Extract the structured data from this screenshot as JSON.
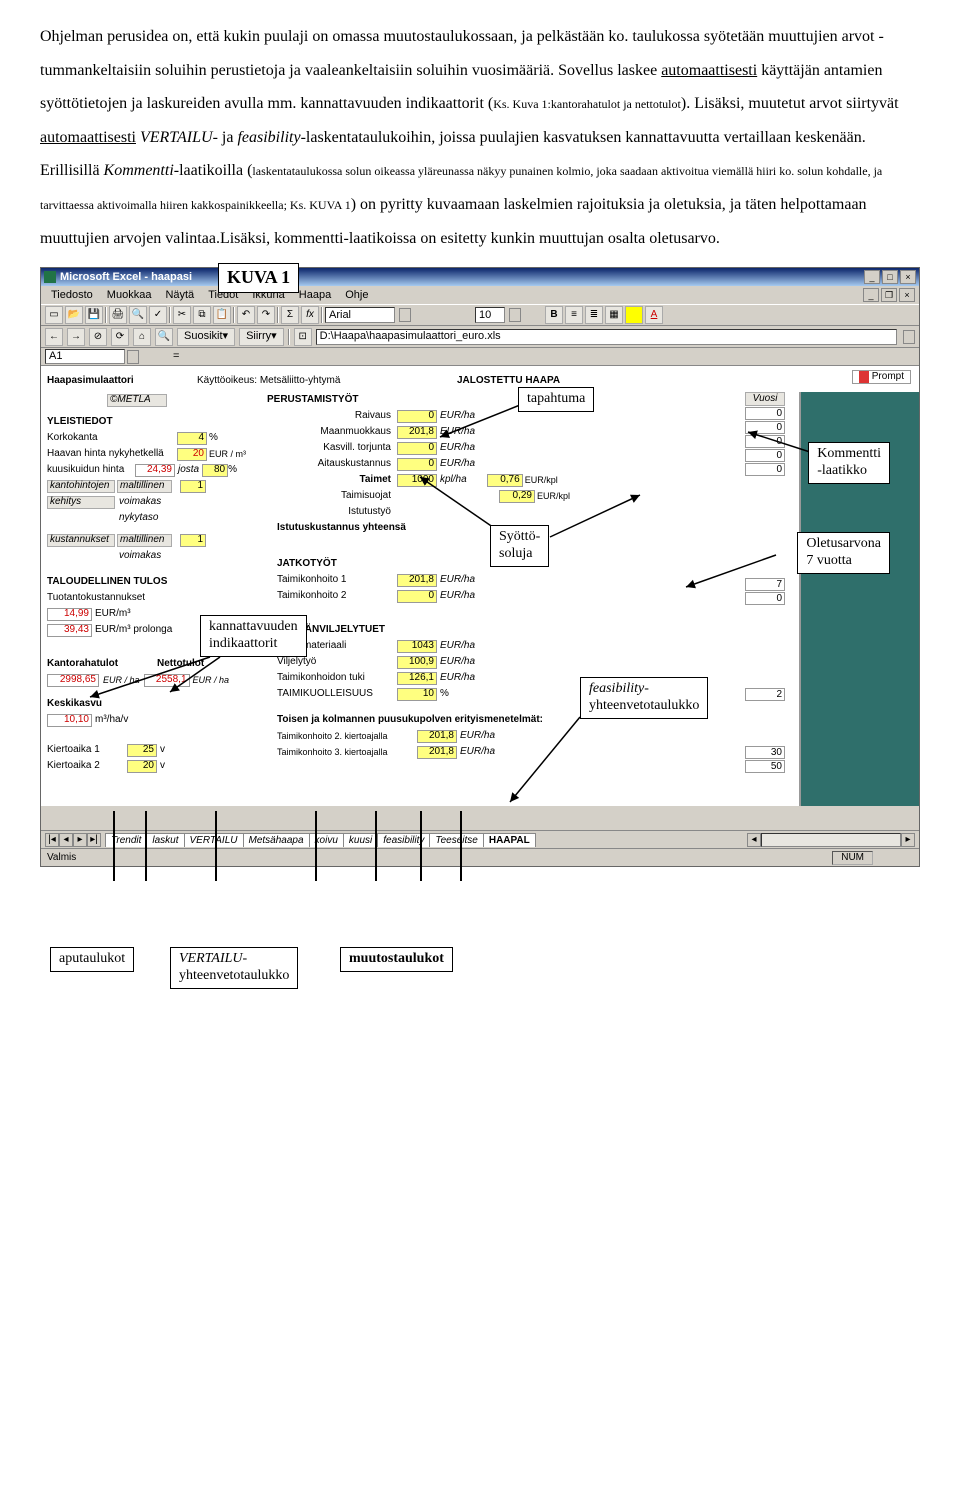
{
  "text": {
    "para": "Ohjelman perusidea on, että kukin puulaji on omassa muutostaulukossaan, ja pelkästään ko. taulukossa syötetään muuttujien arvot - tummankeltaisiin soluihin perustietoja ja vaaleankeltaisiin soluihin vuosimääriä. Sovellus laskee ",
    "ul1": "automaattisesti",
    "para2": " käyttäjän antamien syöttötietojen ja laskureiden avulla mm. kannattavuuden indikaattorit (",
    "small1": "Ks. Kuva 1:kantorahatulot ja nettotulot",
    "para3": "). Lisäksi, muutetut arvot siirtyvät ",
    "ul2": "automaattisesti",
    "it1": " VERTAILU",
    "para4": "- ja ",
    "it2": "feasibility",
    "para5": "-laskentataulukoihin, joissa puulajien kasvatuksen kannattavuutta vertaillaan keskenään. Erillisillä ",
    "it3": "Kommentti",
    "para6": "-laatikoilla (",
    "small2": "laskentataulukossa solun oikeassa yläreunassa näkyy punainen kolmio, joka saadaan aktivoitua viemällä hiiri ko. solun kohdalle, ja tarvittaessa aktivoimalla hiiren kakkospainikkeella; Ks. KUVA 1",
    "para7": ") on pyritty kuvaamaan laskelmien rajoituksia ja oletuksia, ja täten helpottamaan muuttujien arvojen valintaa.Lisäksi, kommentti-laatikoissa on esitetty kunkin muuttujan osalta oletusarvo."
  },
  "excel": {
    "title": "Microsoft Excel - haapasi",
    "menus": [
      "Tiedosto",
      "Muokkaa",
      "Näytä",
      "",
      "",
      "",
      "Tiedot",
      "Ikkuna",
      "Haapa",
      "Ohje"
    ],
    "font": "Arial",
    "fontsize": "10",
    "nav_suosikit": "Suosikit",
    "nav_siirry": "Siirry",
    "path": "D:\\Haapa\\haapasimulaattori_euro.xls",
    "namebox": "A1",
    "prompt": "Prompt",
    "status": "Valmis",
    "num": "NUM",
    "tabs": [
      "Trendit",
      "laskut",
      "VERTAILU",
      "Metsähaapa",
      "koivu",
      "kuusi",
      "feasibility",
      "Teeseitse",
      "HAAPAL"
    ],
    "sheet": {
      "heading_app": "Haapasimulaattori",
      "kayttooikeus": "Käyttöoikeus: Metsäliitto-yhtymä",
      "jalostettu": "JALOSTETTU HAAPA",
      "metla": "©METLA",
      "perustamistyot": "PERUSTAMISTYÖT",
      "vuosi": "Vuosi",
      "yleistiedot": "YLEISTIEDOT",
      "korkokanta": "Korkokanta",
      "korkokanta_v": "4",
      "pct": "%",
      "haavanhinta": "Haavan hinta nykyhetkellä",
      "haavanhinta_v": "20",
      "eurm3": "EUR / m³",
      "kuusikuidun": "kuusikuidun hinta",
      "kuusikuidun_v": "24,39",
      "josta": "josta",
      "josta_v": "80",
      "kantohintojen": "kantohintojen",
      "kehitys": "kehitys",
      "maltillinen": "maltillinen",
      "maltillinen_v": "1",
      "voimakas": "voimakas",
      "nykytaso": "nykytaso",
      "kustannukset": "kustannukset",
      "taloudellinen": "TALOUDELLINEN TULOS",
      "tuotanto": "Tuotantokustannukset",
      "tuotanto_v1": "14,99",
      "eurm3b": "EUR/m³",
      "tuotanto_v2": "39,43",
      "prolonga": "EUR/m³ prolonga",
      "kantorahatulot": "Kantorahatulot",
      "nettotulot": "Nettotulot",
      "kantoraha_v": "2998,65",
      "eurha": "EUR / ha",
      "netto_v": "2558,1",
      "keskikasvu": "Keskikasvu",
      "keskikasvu_v": "10,10",
      "m3hav": "m³/ha/v",
      "kierto1": "Kiertoaika 1",
      "kierto1_v": "25",
      "v": "v",
      "kierto2": "Kiertoaika 2",
      "kierto2_v": "20",
      "raivaus": "Raivaus",
      "raivaus_v": "0",
      "eurha2": "EUR/ha",
      "maanmuokkaus": "Maanmuokkaus",
      "maanmuokkaus_v": "201,8",
      "kasvill": "Kasvill. torjunta",
      "kasvill_v": "0",
      "aitaus": "Aitauskustannus",
      "aitaus_v": "0",
      "taimet": "Taimet",
      "taimet_v": "1000",
      "kplha": "kpl/ha",
      "taimet_p": "0,76",
      "eurkpl": "EUR/kpl",
      "taimisuojat": "Taimisuojat",
      "taimisuojat_p": "0,29",
      "istutustyo": "Istutustyö",
      "istutusyht": "Istutuskustannus yhteensä",
      "jatkotyot": "JATKOTYÖT",
      "taimikon1": "Taimikonhoito 1",
      "taimikon1_v": "201,8",
      "taimikon2": "Taimikonhoito 2",
      "taimikon2_v": "0",
      "metsanviljely": "METSÄNVILJELYTUET",
      "viljelymateriaali": "Viljelymateriaali",
      "viljelymateriaali_v": "1043",
      "viljelytyo": "Viljelytyö",
      "viljelytyo_v": "100,9",
      "taimikonhoidontuki": "Taimikonhoidon tuki",
      "taimikonhoidontuki_v": "126,1",
      "taimikuolleisuus": "TAIMIKUOLLEISUUS",
      "taimikuolleisuus_v": "10",
      "toisen": "Toisen ja kolmannen puusukupolven erityismenetelmät:",
      "taimikonh2": "Taimikonhoito 2. kiertoajalla",
      "taimikonh2_v": "201,8",
      "taimikonh3": "Taimikonhoito 3. kiertoajalla",
      "taimikonh3_v": "201,8",
      "r7": "7",
      "r0": "0",
      "r2": "2",
      "r30": "30",
      "r50": "50"
    }
  },
  "callouts": {
    "kuva1": "KUVA 1",
    "tapahtuma": "tapahtuma",
    "kommentti1": "Kommentti",
    "kommentti2": "-laatikko",
    "syotto1": "Syöttö-",
    "syotto2": "soluja",
    "oletus1": "Oletusarvona",
    "oletus2": "7 vuotta",
    "kannatt1": "kannattavuuden",
    "kannatt2": "indikaattorit",
    "feas1": "feasibility-",
    "feas2": "yhteenvetotaulukko",
    "aputaulukot": "aputaulukot",
    "vertailu1": "VERTAILU-",
    "vertailu2": "yhteenvetotaulukko",
    "muutostaulukot": "muutostaulukot"
  }
}
